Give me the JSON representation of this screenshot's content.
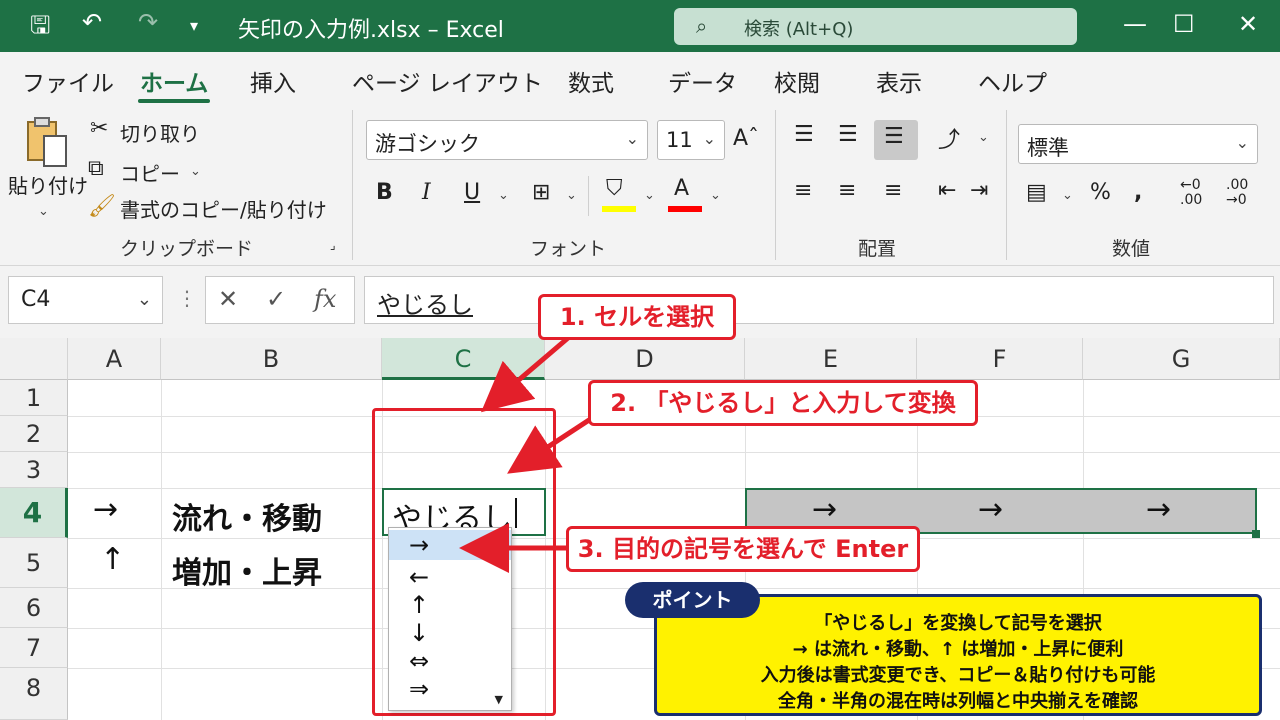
{
  "window": {
    "title": "矢印の入力例.xlsx  –  Excel",
    "search_placeholder": "検索 (Alt+Q)"
  },
  "ribbon_tabs": [
    "ファイル",
    "ホーム",
    "挿入",
    "ページ レイアウト",
    "数式",
    "データ",
    "校閲",
    "表示",
    "ヘルプ"
  ],
  "active_tab": "ホーム",
  "clipboard": {
    "paste": "貼り付け",
    "cut": "切り取り",
    "copy": "コピー",
    "format_painter": "書式のコピー/貼り付け",
    "label": "クリップボード"
  },
  "font": {
    "name": "游ゴシック",
    "size": "11",
    "label": "フォント",
    "highlight_color": "#ffff00",
    "font_color": "#ff0000"
  },
  "alignment": {
    "label": "配置"
  },
  "number": {
    "format": "標準",
    "label": "数値"
  },
  "formula_bar": {
    "name_box": "C4",
    "formula": "やじるし"
  },
  "columns": [
    "A",
    "B",
    "C",
    "D",
    "E",
    "F",
    "G"
  ],
  "selected_column": "C",
  "rows": [
    "1",
    "2",
    "3",
    "4",
    "5",
    "6",
    "7",
    "8"
  ],
  "selected_row": "4",
  "cells": {
    "A4": "→",
    "B4": "流れ・移動",
    "A5": "↑",
    "B5": "増加・上昇",
    "C4": "やじるし",
    "E4": "→",
    "F4": "→",
    "G4": "→"
  },
  "dropdown_items": [
    "→",
    "←",
    "↑",
    "↓",
    "⇔",
    "⇒"
  ],
  "callouts": {
    "step1": "1. セルを選択",
    "step2": "2. 「やじるし」と入力して変換",
    "step3": "3. 目的の記号を選んで Enter"
  },
  "point": {
    "tag": "ポイント",
    "lines": [
      "「やじるし」を変換して記号を選択",
      "→ は流れ・移動、↑ は増加・上昇に便利",
      "入力後は書式変更でき、コピー＆貼り付けも可能",
      "全角・半角の混在時は列幅と中央揃えを確認"
    ]
  },
  "colors": {
    "excel_green": "#1e7145",
    "annotation_red": "#e31f2a",
    "point_yellow": "#fff200",
    "point_navy": "#1a2f6e"
  }
}
